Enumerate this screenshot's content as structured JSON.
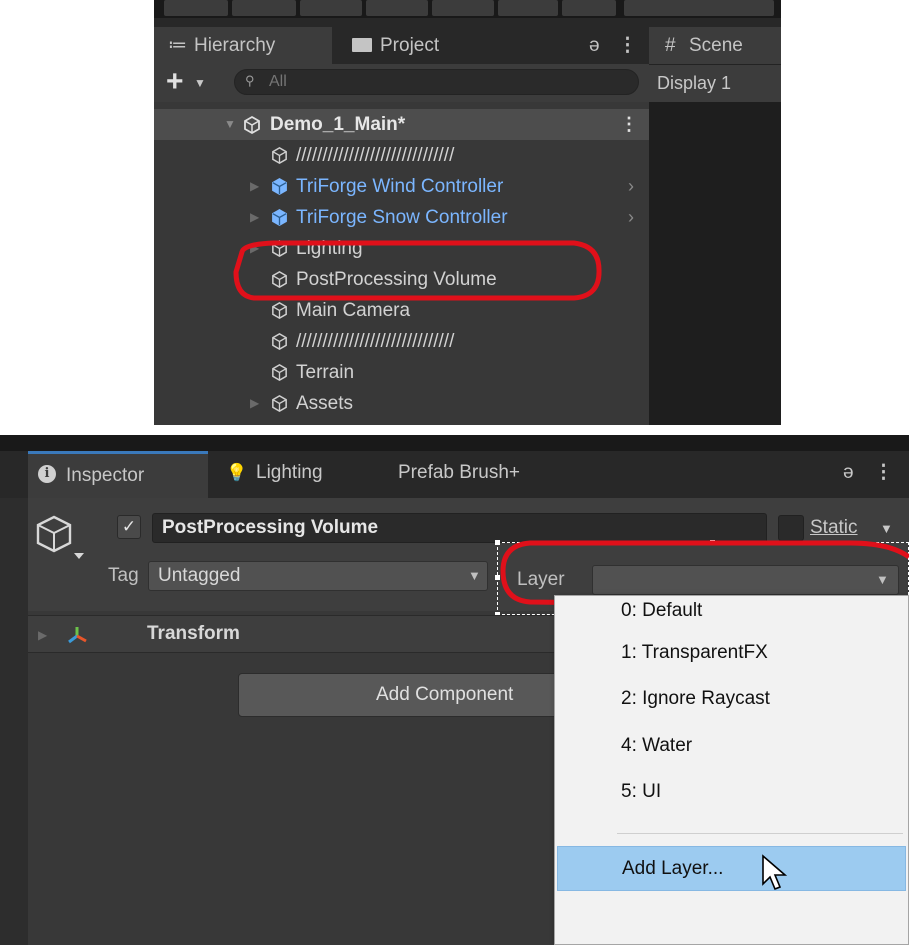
{
  "hierarchy": {
    "tab_hierarchy": "Hierarchy",
    "tab_project": "Project",
    "search_placeholder": "All",
    "scene_root": "Demo_1_Main*",
    "items": [
      {
        "label": "//////////////////////////////",
        "type": "object",
        "expand": false,
        "chevron": false
      },
      {
        "label": "TriForge Wind Controller",
        "type": "prefab",
        "expand": true,
        "chevron": true
      },
      {
        "label": "TriForge Snow Controller",
        "type": "prefab",
        "expand": true,
        "chevron": true
      },
      {
        "label": "Lighting",
        "type": "object",
        "expand": true,
        "chevron": false
      },
      {
        "label": "PostProcessing Volume",
        "type": "object",
        "expand": false,
        "chevron": false
      },
      {
        "label": "Main Camera",
        "type": "object",
        "expand": false,
        "chevron": false
      },
      {
        "label": "//////////////////////////////",
        "type": "object",
        "expand": false,
        "chevron": false
      },
      {
        "label": "Terrain",
        "type": "object",
        "expand": false,
        "chevron": false
      },
      {
        "label": "Assets",
        "type": "object",
        "expand": true,
        "chevron": false
      }
    ]
  },
  "scene": {
    "tab_label": "Scene",
    "display": "Display 1"
  },
  "inspector": {
    "tab_inspector": "Inspector",
    "tab_lighting": "Lighting",
    "tab_prefab_brush": "Prefab Brush+",
    "object_name": "PostProcessing Volume",
    "active_check": "✓",
    "static_label": "Static",
    "tag_label": "Tag",
    "tag_value": "Untagged",
    "layer_label": "Layer",
    "layer_value": "",
    "transform_label": "Transform",
    "add_component": "Add Component"
  },
  "layer_menu": {
    "items": [
      "0: Default",
      "1: TransparentFX",
      "2: Ignore Raycast",
      "4: Water",
      "5: UI"
    ],
    "add_layer": "Add Layer..."
  },
  "colors": {
    "highlight_red": "#e0101a",
    "prefab_blue": "#7bb6ff",
    "menu_hover": "#9ccbf0",
    "tab_accent": "#3a79bb"
  }
}
